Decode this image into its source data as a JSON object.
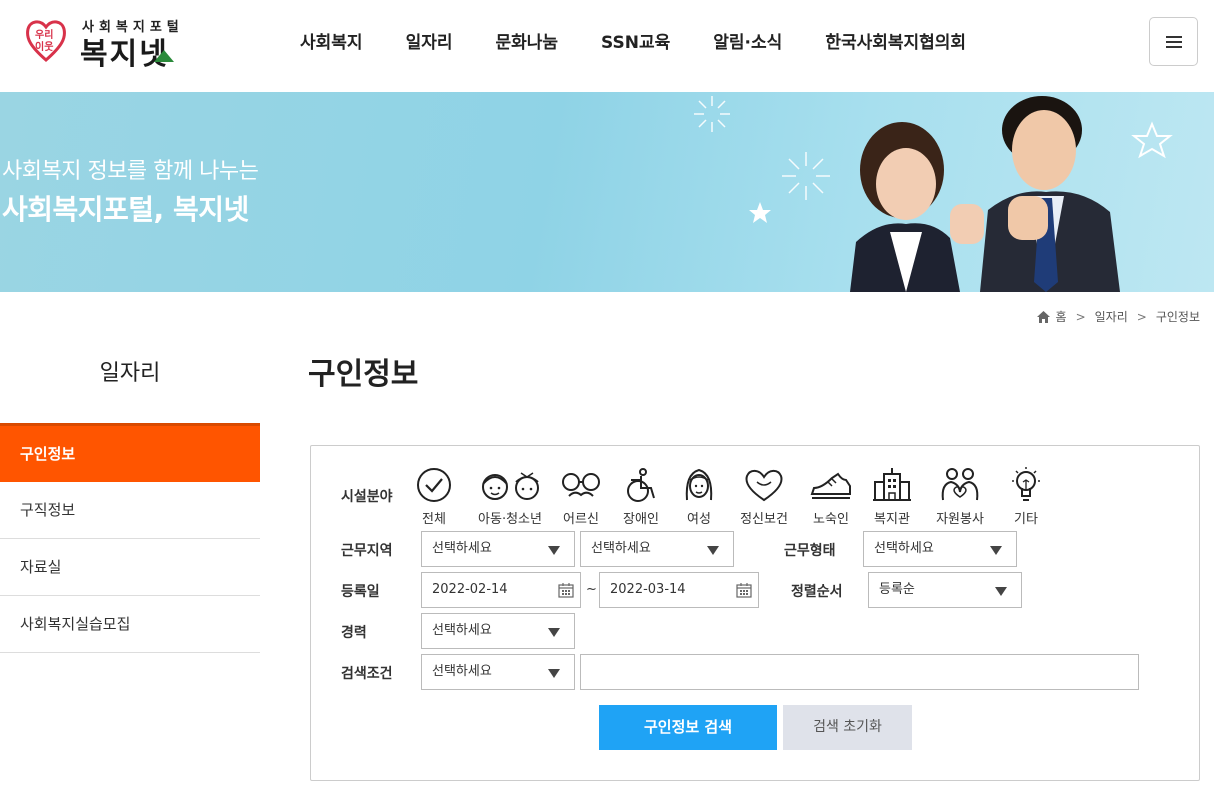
{
  "header": {
    "logo_top": "사회복지포털",
    "logo_main": "복지넷",
    "logo_badge": "우리 이웃",
    "nav": [
      "사회복지",
      "일자리",
      "문화나눔",
      "SSN교육",
      "알림·소식",
      "한국사회복지협의회"
    ],
    "menu_icon": "hamburger-icon"
  },
  "banner": {
    "line1": "사회복지 정보를 함께 나누는",
    "line2": "사회복지포털, 복지넷"
  },
  "breadcrumb": [
    "홈",
    "일자리",
    "구인정보"
  ],
  "side": {
    "title": "일자리",
    "items": [
      "구인정보",
      "구직정보",
      "자료실",
      "사회복지실습모집"
    ]
  },
  "page_title": "구인정보",
  "search": {
    "facility_label": "시설분야",
    "categories": [
      {
        "label": "전체",
        "icon": "check-circle-icon"
      },
      {
        "label": "아동·청소년",
        "icon": "children-icon"
      },
      {
        "label": "어르신",
        "icon": "glasses-mustache-icon"
      },
      {
        "label": "장애인",
        "icon": "wheelchair-icon"
      },
      {
        "label": "여성",
        "icon": "woman-icon"
      },
      {
        "label": "정신보건",
        "icon": "heart-icon"
      },
      {
        "label": "노숙인",
        "icon": "shoe-icon"
      },
      {
        "label": "복지관",
        "icon": "building-icon"
      },
      {
        "label": "자원봉사",
        "icon": "volunteer-icon"
      },
      {
        "label": "기타",
        "icon": "lightbulb-icon"
      }
    ],
    "region_label": "근무지역",
    "region_1": "선택하세요",
    "region_2": "선택하세요",
    "worktype_label": "근무형태",
    "worktype": "선택하세요",
    "date_label": "등록일",
    "date_from": "2022-02-14",
    "date_sep": "~",
    "date_to": "2022-03-14",
    "sort_label": "정렬순서",
    "sort": "등록순",
    "career_label": "경력",
    "career": "선택하세요",
    "cond_label": "검색조건",
    "cond": "선택하세요",
    "keyword": "",
    "search_btn": "구인정보 검색",
    "reset_btn": "검색 초기화"
  },
  "colors": {
    "accent_orange": "#ff5500",
    "button_blue": "#1fa3f5"
  }
}
